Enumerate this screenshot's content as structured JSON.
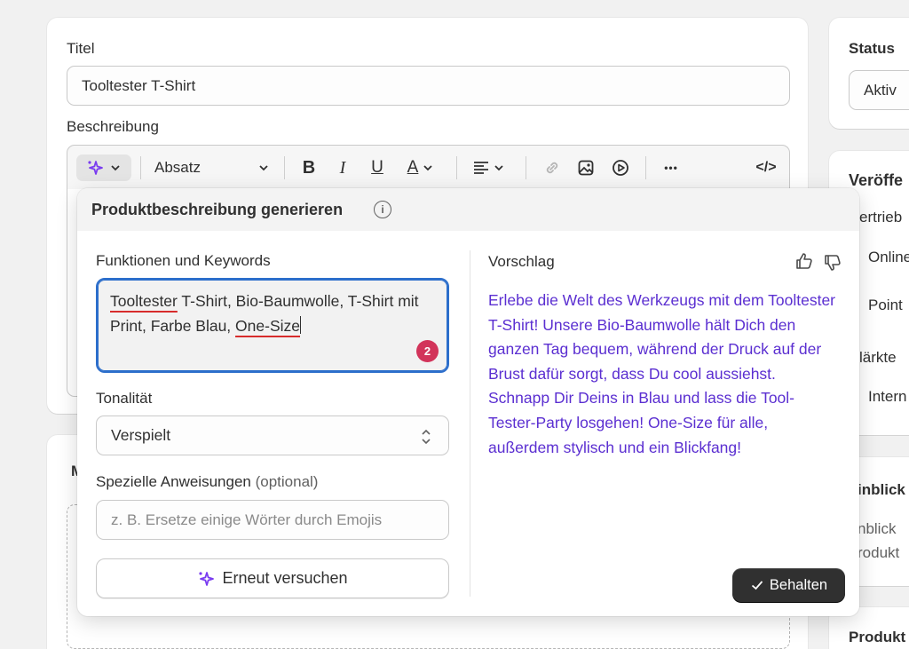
{
  "colors": {
    "accent": "#2c6ecb",
    "suggestion_text": "#5b2fd1",
    "badge": "#d2345a",
    "primary_button": "#303030"
  },
  "product": {
    "title_label": "Titel",
    "title_value": "Tooltester T-Shirt",
    "description_label": "Beschreibung"
  },
  "toolbar": {
    "ai_icon": "sparkle-icon",
    "paragraph_select": "Absatz",
    "bold": "B",
    "italic": "I",
    "underline": "U",
    "text_color": "A",
    "code": "</>",
    "more": "•••"
  },
  "popup": {
    "title": "Produktbeschreibung generieren",
    "info": "i",
    "features_label": "Funktionen und Keywords",
    "features_kw1": "Tooltester",
    "features_mid": " T-Shirt, Bio-Baumwolle, T-Shirt mit Print, Farbe Blau, ",
    "features_kw2": "One-Size",
    "issue_count": "2",
    "tone_label": "Tonalität",
    "tone_value": "Verspielt",
    "instructions_label": "Spezielle Anweisungen",
    "instructions_optional": "(optional)",
    "instructions_placeholder": "z. B. Ersetze einige Wörter durch Emojis",
    "retry_label": "Erneut versuchen",
    "suggestion_label": "Vorschlag",
    "suggestion_text": "Erlebe die Welt des Werkzeugs mit dem Tooltester T-Shirt! Unsere Bio-Baumwolle hält Dich den ganzen Tag bequem, während der Druck auf der Brust dafür sorgt, dass Du cool aussiehst. Schnapp Dir Deins in Blau und lass die Tool-Tester-Party losgehen! One-Size für alle, außerdem stylisch und ein Blickfang!",
    "keep_label": "Behalten"
  },
  "sidebar": {
    "status_label": "Status",
    "status_value": "Aktiv",
    "publish_label": "Veröffe",
    "channels_label": "ertrieb",
    "channel_online": "Online",
    "channel_pos": "Point",
    "markets_label": "lärkte",
    "market_intl": "Intern",
    "insights_label": "inblick",
    "insights_text1": "nblick",
    "insights_text2": "rodukt",
    "product_org_label": "Produkt"
  },
  "media": {
    "label_partial": "M"
  }
}
